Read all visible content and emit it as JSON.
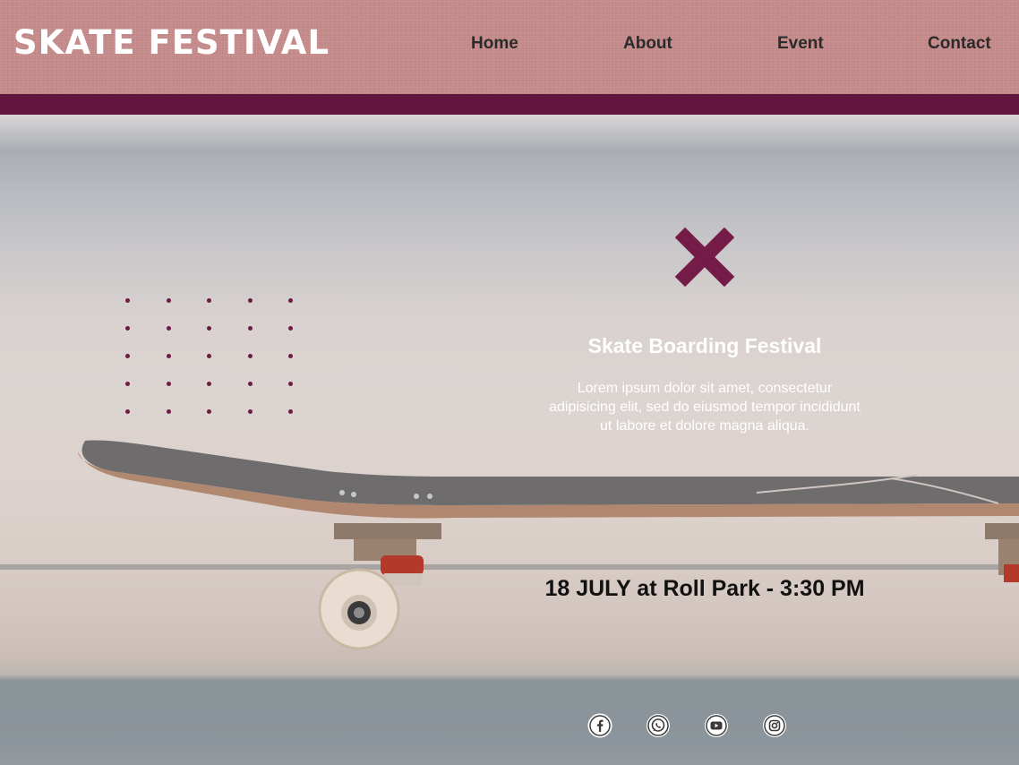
{
  "header": {
    "brand": "SKATE FESTIVAL",
    "nav": [
      "Home",
      "About",
      "Event",
      "Contact"
    ]
  },
  "hero": {
    "icon": "x-icon",
    "title": "Skate Boarding Festival",
    "body": "Lorem ipsum dolor sit amet, consectetur adipisicing elit, sed do eiusmod tempor incididunt ut labore et dolore magna aliqua.",
    "event": "18 JULY at Roll Park - 3:30 PM"
  },
  "socials": [
    "facebook-icon",
    "whatsapp-icon",
    "youtube-icon",
    "instagram-icon"
  ],
  "colors": {
    "header_bg": "#c48a89",
    "accent": "#62153e",
    "text_light": "#ffffff",
    "text_dark": "#2b2b2b"
  }
}
